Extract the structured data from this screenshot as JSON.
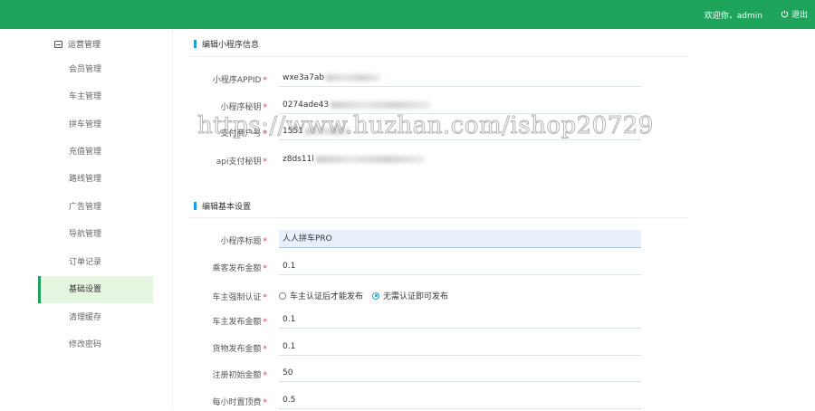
{
  "header": {
    "welcome": "欢迎你，admin",
    "logout_label": "退出"
  },
  "sidebar": {
    "group_label": "运营管理",
    "items": [
      {
        "label": "会员管理"
      },
      {
        "label": "车主管理"
      },
      {
        "label": "拼车管理"
      },
      {
        "label": "充值管理"
      },
      {
        "label": "路线管理"
      },
      {
        "label": "广告管理"
      },
      {
        "label": "导航管理"
      },
      {
        "label": "订单记录"
      },
      {
        "label": "基础设置",
        "active": true
      },
      {
        "label": "清理缓存"
      },
      {
        "label": "修改密码"
      }
    ]
  },
  "section1": {
    "title": "编辑小程序信息",
    "fields": [
      {
        "label": "小程序APPID",
        "value": "wxe3a7ab"
      },
      {
        "label": "小程序秘钥",
        "value": "0274ade43"
      },
      {
        "label": "支付商户号",
        "value": "1551"
      },
      {
        "label": "api支付秘钥",
        "value": "z8ds11l"
      }
    ]
  },
  "section2": {
    "title": "编辑基本设置",
    "app_name": {
      "label": "小程序标题",
      "value": "人人拼车PRO"
    },
    "passenger_fee": {
      "label": "乘客发布金额",
      "value": "0.1"
    },
    "owner_verify": {
      "label": "车主强制认证",
      "options": [
        "车主认证后才能发布",
        "无需认证即可发布"
      ],
      "selected": 1
    },
    "owner_fee": {
      "label": "车主发布金额",
      "value": "0.1"
    },
    "goods_fee": {
      "label": "货物发布金额",
      "value": "0.1"
    },
    "initial_amount": {
      "label": "注册初始金额",
      "value": "50"
    },
    "top_fee": {
      "label": "每小时置顶费",
      "value": "0.5"
    }
  },
  "watermark": "https://www.huzhan.com/ishop20729",
  "colors": {
    "brand": "#1da35a",
    "accent": "#1a9fd9",
    "required": "#e03c3c"
  }
}
